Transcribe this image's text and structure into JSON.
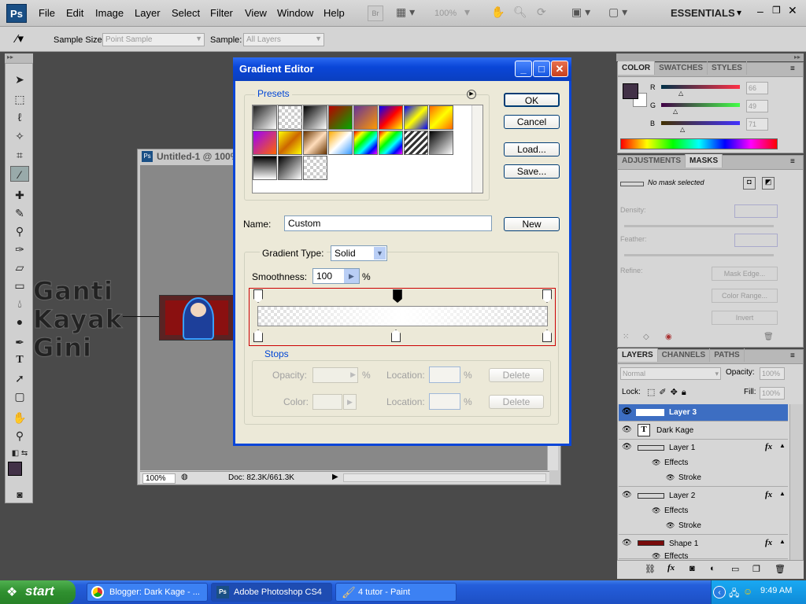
{
  "menubar": {
    "logo": "Ps",
    "items": [
      "File",
      "Edit",
      "Image",
      "Layer",
      "Select",
      "Filter",
      "View",
      "Window",
      "Help"
    ],
    "zoom": "100%",
    "bridge": "Br",
    "workspace": "ESSENTIALS"
  },
  "options": {
    "sample_size_label": "Sample Size:",
    "sample_size_value": "Point Sample",
    "sample_label": "Sample:",
    "sample_value": "All Layers"
  },
  "document": {
    "title": "Untitled-1 @ 100%",
    "zoom": "100%",
    "doc_info": "Doc: 82.3K/661.3K",
    "artwork_text": [
      "Ganti",
      "Kayak",
      "Gini"
    ]
  },
  "dialog": {
    "title": "Gradient Editor",
    "presets_legend": "Presets",
    "ok": "OK",
    "cancel": "Cancel",
    "load": "Load...",
    "save": "Save...",
    "name_label": "Name:",
    "name_value": "Custom",
    "new": "New",
    "gradient_type_label": "Gradient Type:",
    "gradient_type_value": "Solid",
    "smoothness_label": "Smoothness:",
    "smoothness_value": "100",
    "percent": "%",
    "stops_legend": "Stops",
    "opacity_label": "Opacity:",
    "color_label": "Color:",
    "location_label": "Location:",
    "delete": "Delete"
  },
  "color_panel": {
    "tabs": [
      "COLOR",
      "SWATCHES",
      "STYLES"
    ],
    "r_label": "R",
    "r_value": "66",
    "g_label": "G",
    "g_value": "49",
    "b_label": "B",
    "b_value": "71",
    "fg_color": "#423147"
  },
  "adjust_panel": {
    "tabs": [
      "ADJUSTMENTS",
      "MASKS"
    ],
    "no_mask": "No mask selected",
    "density": "Density:",
    "feather": "Feather:",
    "refine": "Refine:",
    "mask_edge": "Mask Edge...",
    "color_range": "Color Range...",
    "invert": "Invert"
  },
  "layers_panel": {
    "tabs": [
      "LAYERS",
      "CHANNELS",
      "PATHS"
    ],
    "blend_mode": "Normal",
    "opacity_label": "Opacity:",
    "opacity_value": "100%",
    "lock_label": "Lock:",
    "fill_label": "Fill:",
    "fill_value": "100%",
    "layers": [
      {
        "name": "Layer 3"
      },
      {
        "name": "Dark Kage"
      },
      {
        "name": "Layer 1",
        "effects": "Effects",
        "stroke": "Stroke"
      },
      {
        "name": "Layer 2",
        "effects": "Effects",
        "stroke": "Stroke"
      },
      {
        "name": "Shape 1",
        "effects": "Effects"
      }
    ],
    "fx": "fx"
  },
  "taskbar": {
    "start": "start",
    "tasks": [
      "Blogger: Dark Kage - ...",
      "Adobe Photoshop CS4",
      "4 tutor - Paint"
    ],
    "clock": "9:49 AM"
  }
}
